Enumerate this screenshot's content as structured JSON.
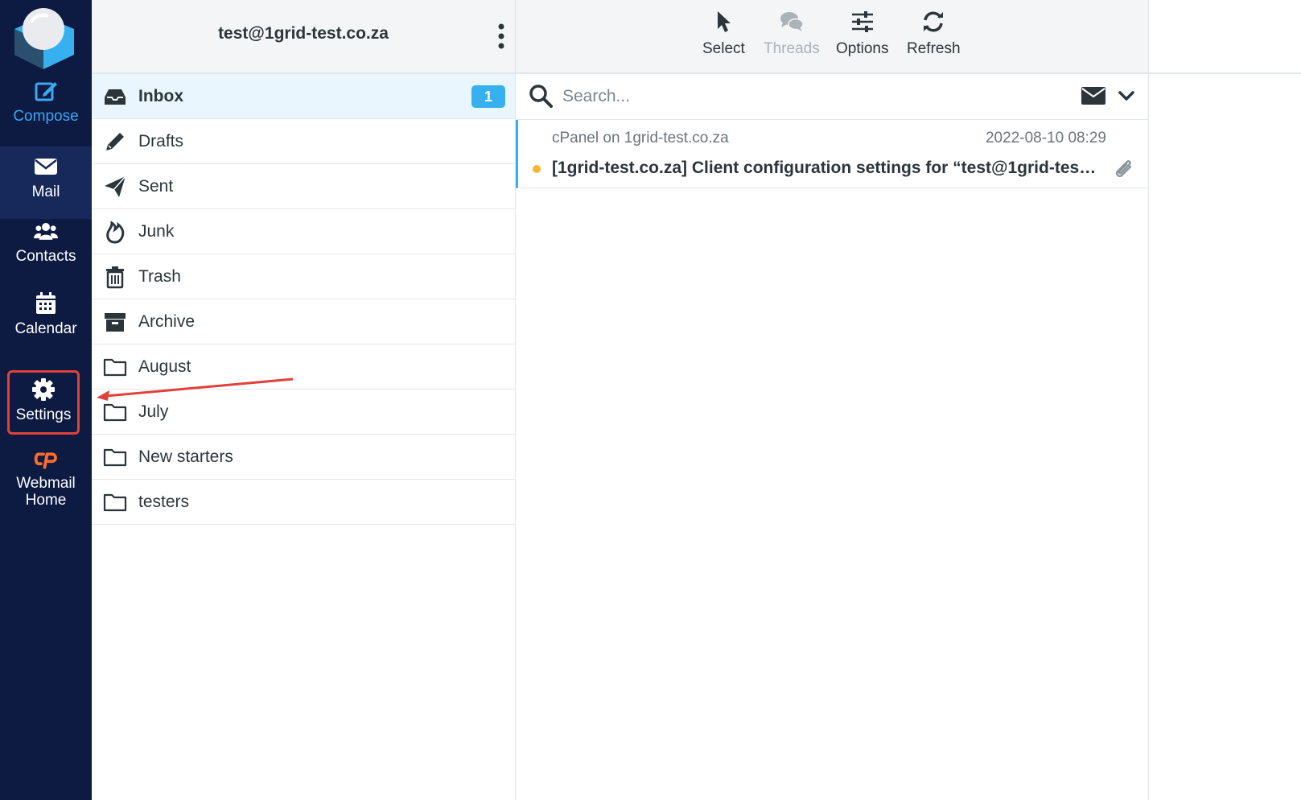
{
  "nav": {
    "compose": "Compose",
    "mail": "Mail",
    "contacts": "Contacts",
    "calendar": "Calendar",
    "settings": "Settings",
    "webmail_home_line1": "Webmail",
    "webmail_home_line2": "Home"
  },
  "account": {
    "email": "test@1grid-test.co.za"
  },
  "folders": [
    {
      "label": "Inbox",
      "icon": "inbox-icon",
      "unread": "1",
      "selected": true
    },
    {
      "label": "Drafts",
      "icon": "pencil-icon"
    },
    {
      "label": "Sent",
      "icon": "paper-plane-icon"
    },
    {
      "label": "Junk",
      "icon": "fire-icon"
    },
    {
      "label": "Trash",
      "icon": "trash-icon"
    },
    {
      "label": "Archive",
      "icon": "archive-box-icon"
    },
    {
      "label": "August",
      "icon": "folder-icon"
    },
    {
      "label": "July",
      "icon": "folder-icon"
    },
    {
      "label": "New starters",
      "icon": "folder-icon"
    },
    {
      "label": "testers",
      "icon": "folder-icon"
    }
  ],
  "toolbar": {
    "select": "Select",
    "threads": "Threads",
    "options": "Options",
    "refresh": "Refresh"
  },
  "search": {
    "placeholder": "Search..."
  },
  "messages": [
    {
      "from": "cPanel on 1grid-test.co.za",
      "date": "2022-08-10 08:29",
      "subject": "[1grid-test.co.za] Client configuration settings for “test@1grid-test....",
      "unread": true,
      "has_attachment": true
    }
  ],
  "colors": {
    "nav_bg": "#0d1a42",
    "accent": "#37b0f0",
    "highlight_border": "#e0423a",
    "unread_dot": "#f7b731"
  }
}
